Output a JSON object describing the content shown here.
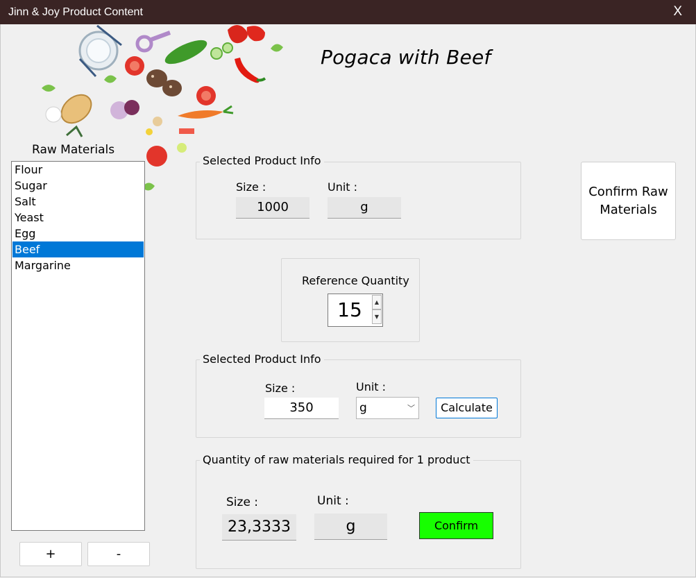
{
  "window": {
    "title": "Jinn & Joy Product Content",
    "close_label": "X"
  },
  "product": {
    "title": "Pogaca with Beef"
  },
  "raw_materials": {
    "label": "Raw Materials",
    "items": [
      {
        "label": "Flour",
        "selected": false
      },
      {
        "label": "Sugar",
        "selected": false
      },
      {
        "label": "Salt",
        "selected": false
      },
      {
        "label": "Yeast",
        "selected": false
      },
      {
        "label": "Egg",
        "selected": false
      },
      {
        "label": "Beef",
        "selected": true
      },
      {
        "label": "Margarine",
        "selected": false
      }
    ],
    "add_label": "+",
    "remove_label": "-"
  },
  "selected_product_info": {
    "title": "Selected Product Info",
    "size_label": "Size :",
    "size_value": "1000",
    "unit_label": "Unit :",
    "unit_value": "g"
  },
  "confirm_raw_materials": {
    "label": "Confirm Raw Materials"
  },
  "reference_quantity": {
    "label": "Reference Quantity",
    "value": "15"
  },
  "selected_product_info_2": {
    "title": "Selected Product Info",
    "size_label": "Size :",
    "size_value": "350",
    "unit_label": "Unit :",
    "unit_value": "g",
    "calculate_label": "Calculate"
  },
  "required_quantity": {
    "title": "Quantity of raw materials required for 1 product",
    "size_label": "Size :",
    "size_value": "23,3333",
    "unit_label": "Unit :",
    "unit_value": "g",
    "confirm_label": "Confirm"
  },
  "colors": {
    "titlebar": "#3a2424",
    "selection": "#0078d7",
    "confirm_button": "#17ff00"
  }
}
